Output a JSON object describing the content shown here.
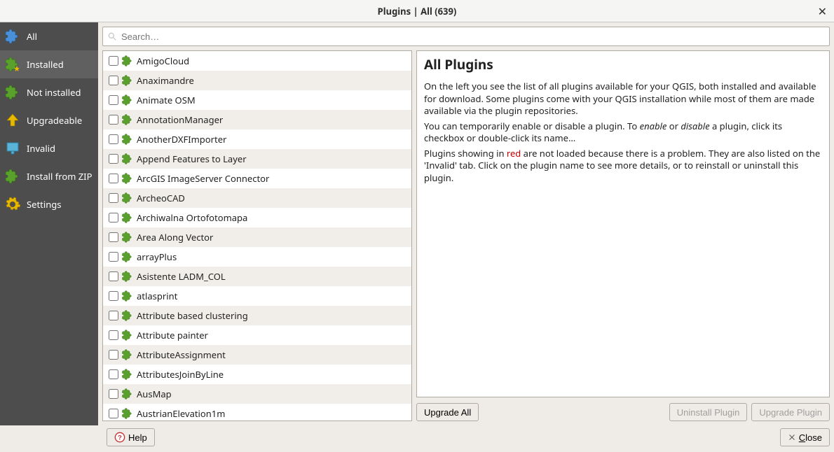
{
  "window": {
    "title": "Plugins | All (639)"
  },
  "sidebar": {
    "items": [
      {
        "label": "All",
        "selected": false
      },
      {
        "label": "Installed",
        "selected": true
      },
      {
        "label": "Not installed",
        "selected": false
      },
      {
        "label": "Upgradeable",
        "selected": false
      },
      {
        "label": "Invalid",
        "selected": false
      },
      {
        "label": "Install from ZIP",
        "selected": false
      },
      {
        "label": "Settings",
        "selected": false
      }
    ]
  },
  "search": {
    "placeholder": "Search…"
  },
  "plugins": [
    {
      "name": "AmigoCloud"
    },
    {
      "name": "Anaximandre"
    },
    {
      "name": "Animate OSM"
    },
    {
      "name": "AnnotationManager"
    },
    {
      "name": "AnotherDXFImporter"
    },
    {
      "name": "Append Features to Layer"
    },
    {
      "name": "ArcGIS ImageServer Connector"
    },
    {
      "name": "ArcheoCAD"
    },
    {
      "name": "Archiwalna Ortofotomapa"
    },
    {
      "name": "Area Along Vector"
    },
    {
      "name": "arrayPlus"
    },
    {
      "name": "Asistente LADM_COL"
    },
    {
      "name": "atlasprint"
    },
    {
      "name": "Attribute based clustering"
    },
    {
      "name": "Attribute painter"
    },
    {
      "name": "AttributeAssignment"
    },
    {
      "name": "AttributesJoinByLine"
    },
    {
      "name": "AusMap"
    },
    {
      "name": "AustrianElevation1m"
    }
  ],
  "detail": {
    "heading": "All Plugins",
    "p1": "On the left you see the list of all plugins available for your QGIS, both installed and available for download. Some plugins come with your QGIS installation while most of them are made available via the plugin repositories.",
    "p2a": "You can temporarily enable or disable a plugin. To ",
    "p2_enable": "enable",
    "p2b": " or ",
    "p2_disable": "disable",
    "p2c": " a plugin, click its checkbox or double-click its name…",
    "p3a": "Plugins showing in ",
    "p3_red": "red",
    "p3b": " are not loaded because there is a problem. They are also listed on the 'Invalid' tab. Click on the plugin name to see more details, or to reinstall or uninstall this plugin."
  },
  "buttons": {
    "upgrade_all": "Upgrade All",
    "uninstall": "Uninstall Plugin",
    "upgrade": "Upgrade Plugin",
    "help": "Help",
    "close": "Close"
  }
}
